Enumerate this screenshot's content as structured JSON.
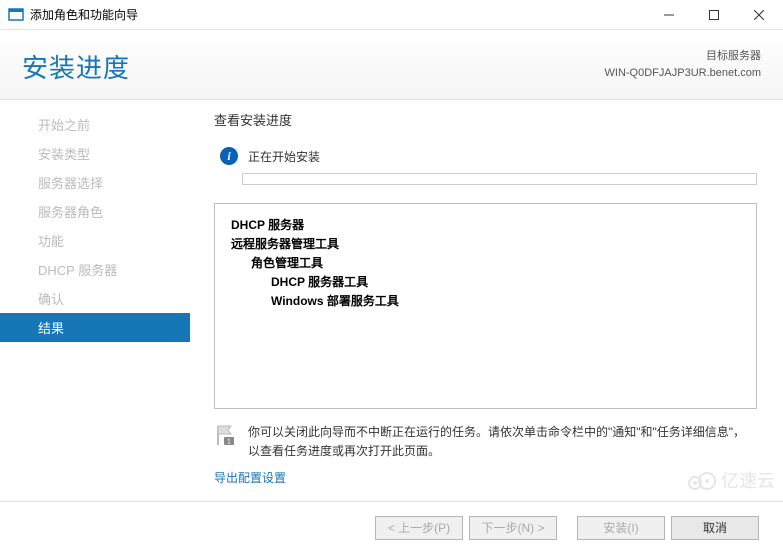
{
  "window": {
    "title": "添加角色和功能向导"
  },
  "header": {
    "page_title": "安装进度",
    "target_label": "目标服务器",
    "target_name": "WIN-Q0DFJAJP3UR.benet.com"
  },
  "sidebar": {
    "items": [
      {
        "label": "开始之前"
      },
      {
        "label": "安装类型"
      },
      {
        "label": "服务器选择"
      },
      {
        "label": "服务器角色"
      },
      {
        "label": "功能"
      },
      {
        "label": "DHCP 服务器"
      },
      {
        "label": "确认"
      },
      {
        "label": "结果"
      }
    ],
    "active_index": 7
  },
  "main": {
    "section_title": "查看安装进度",
    "status_text": "正在开始安装",
    "results": {
      "root": "DHCP 服务器",
      "group1": "远程服务器管理工具",
      "group2": "角色管理工具",
      "leaf1": "DHCP 服务器工具",
      "leaf2": "Windows 部署服务工具"
    },
    "note_badge": "1",
    "note_text": "你可以关闭此向导而不中断正在运行的任务。请依次单击命令栏中的\"通知\"和\"任务详细信息\"，以查看任务进度或再次打开此页面。",
    "export_link": "导出配置设置"
  },
  "footer": {
    "prev": "< 上一步(P)",
    "next": "下一步(N) >",
    "install": "安装(I)",
    "cancel": "取消"
  },
  "watermark": "亿速云"
}
